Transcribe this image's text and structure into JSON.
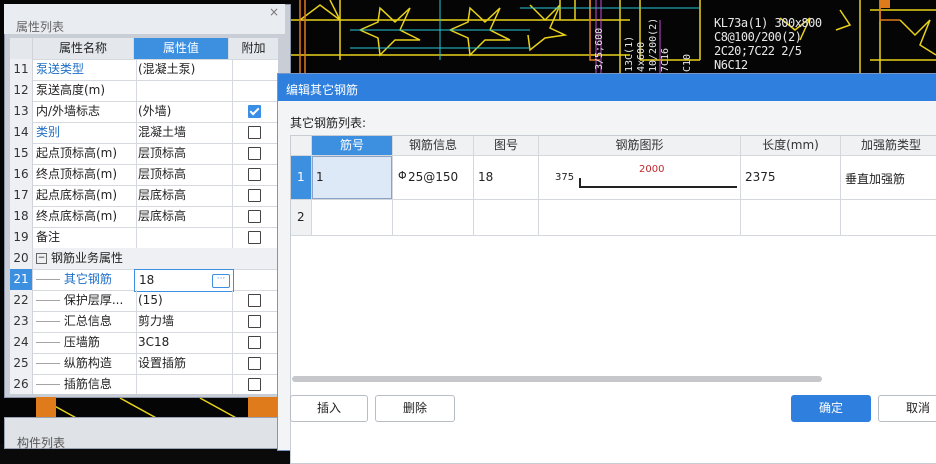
{
  "property_panel": {
    "title": "属性列表",
    "close_icon": "close-icon",
    "headers": {
      "name": "属性名称",
      "value": "属性值",
      "add": "附加"
    },
    "rows": [
      {
        "num": "11",
        "name": "泵送类型",
        "value": "(混凝土泵)",
        "name_blue": true,
        "checkbox": false
      },
      {
        "num": "12",
        "name": "泵送高度(m)",
        "value": "",
        "name_blue": false,
        "checkbox": false
      },
      {
        "num": "13",
        "name": "内/外墙标志",
        "value": "(外墙)",
        "name_blue": false,
        "checkbox": true,
        "checked": true
      },
      {
        "num": "14",
        "name": "类别",
        "value": "混凝土墙",
        "name_blue": true,
        "checkbox": true,
        "checked": false
      },
      {
        "num": "15",
        "name": "起点顶标高(m)",
        "value": "层顶标高",
        "name_blue": false,
        "checkbox": true,
        "checked": false
      },
      {
        "num": "16",
        "name": "终点顶标高(m)",
        "value": "层顶标高",
        "name_blue": false,
        "checkbox": true,
        "checked": false
      },
      {
        "num": "17",
        "name": "起点底标高(m)",
        "value": "层底标高",
        "name_blue": false,
        "checkbox": true,
        "checked": false
      },
      {
        "num": "18",
        "name": "终点底标高(m)",
        "value": "层底标高",
        "name_blue": false,
        "checkbox": true,
        "checked": false
      },
      {
        "num": "19",
        "name": "备注",
        "value": "",
        "name_blue": false,
        "checkbox": true,
        "checked": false
      },
      {
        "num": "20",
        "name": "钢筋业务属性",
        "value": "",
        "name_blue": false,
        "checkbox": false,
        "group": true
      },
      {
        "num": "21",
        "name": "其它钢筋",
        "value": "18",
        "name_blue": true,
        "checkbox": false,
        "selected": true
      },
      {
        "num": "22",
        "name": "保护层厚...",
        "value": "(15)",
        "name_blue": false,
        "checkbox": true,
        "checked": false
      },
      {
        "num": "23",
        "name": "汇总信息",
        "value": "剪力墙",
        "name_blue": false,
        "checkbox": true,
        "checked": false
      },
      {
        "num": "24",
        "name": "压墙筋",
        "value": "3C18",
        "name_blue": false,
        "checkbox": true,
        "checked": false
      },
      {
        "num": "25",
        "name": "纵筋构造",
        "value": "设置插筋",
        "name_blue": false,
        "checkbox": true,
        "checked": false
      },
      {
        "num": "26",
        "name": "插筋信息",
        "value": "",
        "name_blue": false,
        "checkbox": true,
        "checked": false
      }
    ]
  },
  "component_panel": {
    "title": "构件列表"
  },
  "cad_text": [
    "KL73a(1) 300x800",
    "C8@100/200(2)",
    "2C20;7C22 2/5",
    "N6C12"
  ],
  "dialog": {
    "title": "编辑其它钢筋",
    "list_label": "其它钢筋列表:",
    "columns": [
      "筋号",
      "钢筋信息",
      "图号",
      "钢筋图形",
      "长度(mm)",
      "加强筋类型"
    ],
    "rows": [
      {
        "row_num": "1",
        "bar_no": "1",
        "info_symbol": "Φ",
        "info": "25@150",
        "figure_no": "18",
        "shape_left": "375",
        "shape_main": "2000",
        "length": "2375",
        "type": "垂直加强筋"
      },
      {
        "row_num": "2",
        "bar_no": "",
        "info_symbol": "",
        "info": "",
        "figure_no": "",
        "shape_left": "",
        "shape_main": "",
        "length": "",
        "type": ""
      }
    ],
    "buttons": {
      "insert": "插入",
      "delete": "删除",
      "ok": "确定",
      "cancel": "取消"
    },
    "colors": {
      "accent": "#2f7fde",
      "shape_red": "#c0282d"
    }
  }
}
